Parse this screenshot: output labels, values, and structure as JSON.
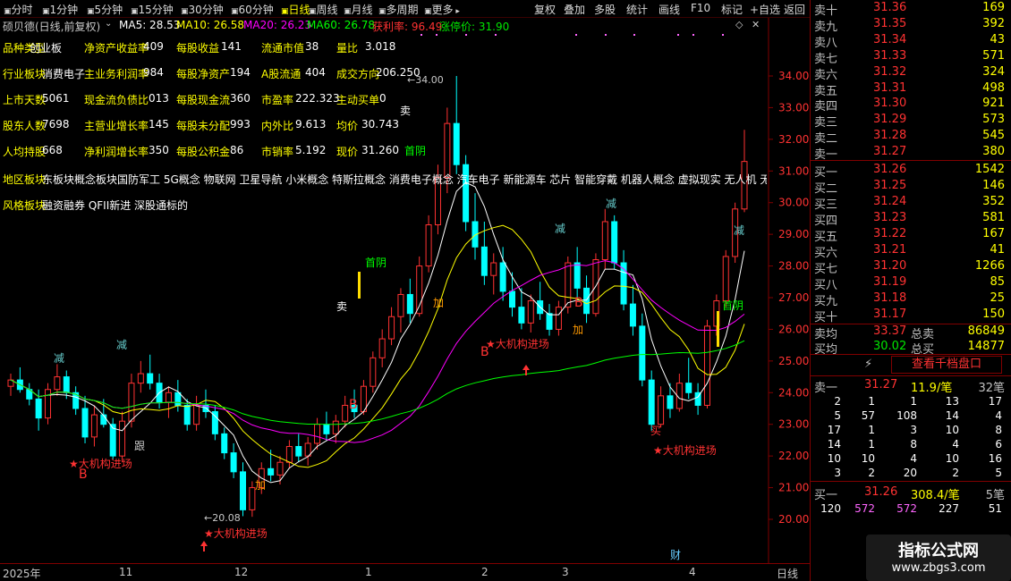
{
  "toolbar": {
    "left_items": [
      "分时",
      "1分钟",
      "5分钟",
      "15分钟",
      "30分钟",
      "60分钟",
      "日线",
      "周线",
      "月线",
      "多周期",
      "更多"
    ],
    "active": "日线",
    "right_items": [
      "复权",
      "叠加",
      "多股",
      "统计",
      "画线",
      "F10",
      "标记",
      "+自选",
      "返回"
    ]
  },
  "title": {
    "stock": "硕贝德(日线,前复权)",
    "ma5": "MA5: 28.53",
    "ma10": "MA10: 26.58",
    "ma20": "MA20: 26.23",
    "ma60": "MA60: 26.78",
    "profit": "获利率: 96.49",
    "limitup": "涨停价: 31.90"
  },
  "info": {
    "row1": [
      [
        "品种类型",
        "创业板"
      ],
      [
        "净资产收益率",
        "409"
      ],
      [
        "每股收益",
        "141"
      ],
      [
        "流通市值",
        "38"
      ],
      [
        "量比",
        "3.018"
      ]
    ],
    "row2": [
      [
        "行业板块",
        "消费电子"
      ],
      [
        "主业务利润率",
        "984"
      ],
      [
        "每股净资产",
        "194"
      ],
      [
        "A股流通",
        "404"
      ],
      [
        "成交方向",
        "206.250"
      ]
    ],
    "row3": [
      [
        "上市天数",
        "5061"
      ],
      [
        "现金流负债比",
        "013"
      ],
      [
        "每股现金流",
        "360"
      ],
      [
        "市盈率",
        "222.323"
      ],
      [
        "主动买单",
        "0"
      ]
    ],
    "row4": [
      [
        "股东人数",
        "7698"
      ],
      [
        "主营业增长率",
        "145"
      ],
      [
        "每股未分配",
        "993"
      ],
      [
        "内外比",
        "9.613"
      ],
      [
        "均价",
        "30.743"
      ]
    ],
    "row5": [
      [
        "人均持股",
        "668"
      ],
      [
        "净利润增长率",
        "350"
      ],
      [
        "每股公积金",
        "86"
      ],
      [
        "市销率",
        "5.192"
      ],
      [
        "现价",
        "31.260"
      ]
    ],
    "region_label": "地区板块",
    "region_value": "东板块概念板块国防军工 5G概念 物联网 卫星导航 小米概念 特斯拉概念 消费电子概念 汽车电子 新能源车 芯片 智能穿戴 机器人概念 虚拟现实 无人机 无",
    "style_label": "风格板块",
    "style_value": "融资融券 QFII新进 深股通标的"
  },
  "chart_data": {
    "type": "candlestick",
    "y_ticks": [
      "34.00",
      "33.00",
      "32.00",
      "31.00",
      "30.00",
      "29.00",
      "28.00",
      "27.00",
      "26.00",
      "25.00",
      "24.00",
      "23.00",
      "22.00",
      "21.00",
      "20.00"
    ],
    "ylim": [
      19.5,
      34.5
    ],
    "x_labels": [
      "2025年",
      "11",
      "12",
      "1",
      "2",
      "3",
      "4"
    ],
    "period_label": "日线",
    "high_mark": "34.00",
    "low_mark": "20.08",
    "candles": [
      [
        24.2,
        24.6,
        23.9,
        24.4
      ],
      [
        24.4,
        24.8,
        24.0,
        24.1
      ],
      [
        24.1,
        24.3,
        23.6,
        23.8
      ],
      [
        23.8,
        24.1,
        22.8,
        23.2
      ],
      [
        23.2,
        24.3,
        23.0,
        24.1
      ],
      [
        24.1,
        24.9,
        23.9,
        24.5
      ],
      [
        24.5,
        24.7,
        23.8,
        24.0
      ],
      [
        24.0,
        24.2,
        23.3,
        23.5
      ],
      [
        23.5,
        23.9,
        22.4,
        22.6
      ],
      [
        22.6,
        23.6,
        22.3,
        23.3
      ],
      [
        23.3,
        23.8,
        22.9,
        23.0
      ],
      [
        23.0,
        23.2,
        21.9,
        22.0
      ],
      [
        22.0,
        23.4,
        21.8,
        23.1
      ],
      [
        23.1,
        24.6,
        22.9,
        24.3
      ],
      [
        24.3,
        25.0,
        24.0,
        24.6
      ],
      [
        24.6,
        25.2,
        24.1,
        24.3
      ],
      [
        24.3,
        24.6,
        23.5,
        23.7
      ],
      [
        23.7,
        24.2,
        23.2,
        24.0
      ],
      [
        24.0,
        24.4,
        23.4,
        23.6
      ],
      [
        23.6,
        23.8,
        22.8,
        23.0
      ],
      [
        23.0,
        23.9,
        22.8,
        23.6
      ],
      [
        23.6,
        24.1,
        23.2,
        23.4
      ],
      [
        23.4,
        23.6,
        22.5,
        22.7
      ],
      [
        22.7,
        22.9,
        21.9,
        22.1
      ],
      [
        22.1,
        22.4,
        21.3,
        21.5
      ],
      [
        21.5,
        21.8,
        20.1,
        20.3
      ],
      [
        20.3,
        21.2,
        20.08,
        21.0
      ],
      [
        21.0,
        21.8,
        20.8,
        21.6
      ],
      [
        21.6,
        22.2,
        21.2,
        21.4
      ],
      [
        21.4,
        22.0,
        21.1,
        21.8
      ],
      [
        21.8,
        22.5,
        21.6,
        22.3
      ],
      [
        22.3,
        22.7,
        21.8,
        22.0
      ],
      [
        22.0,
        22.6,
        21.7,
        22.4
      ],
      [
        22.4,
        23.2,
        22.2,
        23.0
      ],
      [
        23.0,
        23.4,
        22.5,
        22.7
      ],
      [
        22.7,
        23.3,
        22.4,
        23.1
      ],
      [
        23.1,
        23.9,
        22.9,
        23.6
      ],
      [
        23.6,
        24.1,
        23.2,
        23.4
      ],
      [
        23.4,
        24.4,
        23.3,
        24.2
      ],
      [
        24.2,
        25.3,
        24.0,
        25.1
      ],
      [
        25.1,
        26.0,
        24.8,
        25.7
      ],
      [
        25.7,
        26.7,
        25.5,
        26.4
      ],
      [
        26.4,
        27.3,
        25.9,
        27.1
      ],
      [
        27.1,
        27.6,
        26.2,
        26.5
      ],
      [
        26.5,
        28.3,
        26.4,
        28.0
      ],
      [
        28.0,
        29.6,
        27.8,
        29.3
      ],
      [
        29.3,
        31.2,
        29.0,
        30.8
      ],
      [
        30.8,
        33.0,
        30.3,
        32.5
      ],
      [
        32.5,
        34.0,
        30.9,
        31.2
      ],
      [
        31.2,
        31.5,
        29.1,
        29.4
      ],
      [
        29.4,
        30.3,
        28.2,
        28.6
      ],
      [
        28.6,
        29.4,
        27.4,
        27.7
      ],
      [
        27.7,
        28.4,
        27.1,
        28.1
      ],
      [
        28.1,
        28.6,
        26.9,
        27.2
      ],
      [
        27.2,
        27.8,
        26.4,
        26.7
      ],
      [
        26.7,
        27.3,
        26.0,
        26.2
      ],
      [
        26.2,
        27.1,
        25.9,
        26.9
      ],
      [
        26.9,
        27.5,
        26.3,
        26.5
      ],
      [
        26.5,
        26.8,
        25.8,
        26.0
      ],
      [
        26.0,
        26.9,
        25.8,
        26.7
      ],
      [
        26.7,
        28.3,
        26.5,
        28.1
      ],
      [
        28.1,
        28.6,
        27.0,
        27.3
      ],
      [
        27.3,
        27.7,
        26.2,
        26.5
      ],
      [
        26.5,
        28.4,
        26.4,
        28.2
      ],
      [
        28.2,
        29.8,
        27.9,
        29.4
      ],
      [
        29.4,
        29.6,
        27.9,
        28.1
      ],
      [
        28.1,
        28.5,
        26.6,
        26.8
      ],
      [
        26.8,
        27.4,
        25.8,
        26.1
      ],
      [
        26.1,
        26.5,
        24.2,
        24.4
      ],
      [
        24.4,
        24.7,
        22.8,
        23.0
      ],
      [
        23.0,
        24.2,
        22.9,
        23.9
      ],
      [
        23.9,
        24.3,
        23.2,
        23.5
      ],
      [
        23.5,
        24.6,
        23.4,
        24.3
      ],
      [
        24.3,
        25.1,
        23.8,
        24.0
      ],
      [
        24.0,
        24.3,
        23.3,
        23.6
      ],
      [
        23.6,
        26.3,
        23.5,
        26.1
      ],
      [
        26.1,
        27.1,
        25.8,
        26.9
      ],
      [
        26.9,
        28.5,
        26.7,
        28.3
      ],
      [
        28.3,
        30.0,
        28.1,
        29.8
      ],
      [
        29.8,
        32.3,
        29.7,
        31.3
      ]
    ],
    "series": [
      {
        "name": "MA5",
        "color": "#ffffff"
      },
      {
        "name": "MA10",
        "color": "#ffff00"
      },
      {
        "name": "MA20",
        "color": "#ff00ff"
      },
      {
        "name": "MA60",
        "color": "#00ff00"
      }
    ],
    "annotations": [
      "减",
      "卖",
      "B",
      "跟",
      "加",
      "首阴",
      "★大机构进场",
      "买",
      "财",
      "减"
    ]
  },
  "orderbook": {
    "asks": [
      {
        "label": "卖十",
        "price": "31.36",
        "vol": "169"
      },
      {
        "label": "卖九",
        "price": "31.35",
        "vol": "392"
      },
      {
        "label": "卖八",
        "price": "31.34",
        "vol": "43"
      },
      {
        "label": "卖七",
        "price": "31.33",
        "vol": "571"
      },
      {
        "label": "卖六",
        "price": "31.32",
        "vol": "324"
      },
      {
        "label": "卖五",
        "price": "31.31",
        "vol": "498"
      },
      {
        "label": "卖四",
        "price": "31.30",
        "vol": "921"
      },
      {
        "label": "卖三",
        "price": "31.29",
        "vol": "573"
      },
      {
        "label": "卖二",
        "price": "31.28",
        "vol": "545"
      },
      {
        "label": "卖一",
        "price": "31.27",
        "vol": "380"
      }
    ],
    "bids": [
      {
        "label": "买一",
        "price": "31.26",
        "vol": "1542"
      },
      {
        "label": "买二",
        "price": "31.25",
        "vol": "146"
      },
      {
        "label": "买三",
        "price": "31.24",
        "vol": "352"
      },
      {
        "label": "买四",
        "price": "31.23",
        "vol": "581"
      },
      {
        "label": "买五",
        "price": "31.22",
        "vol": "167"
      },
      {
        "label": "买六",
        "price": "31.21",
        "vol": "41"
      },
      {
        "label": "买七",
        "price": "31.20",
        "vol": "1266"
      },
      {
        "label": "买八",
        "price": "31.19",
        "vol": "85"
      },
      {
        "label": "买九",
        "price": "31.18",
        "vol": "25"
      },
      {
        "label": "买十",
        "price": "31.17",
        "vol": "150"
      }
    ],
    "avg_ask_label": "卖均",
    "avg_ask": "33.37",
    "total_ask_label": "总卖",
    "total_ask": "86849",
    "avg_bid_label": "买均",
    "avg_bid": "30.02",
    "total_bid_label": "总买",
    "total_bid": "14877",
    "view_button": "查看千档盘口",
    "sell1_label": "卖一",
    "sell1_price": "31.27",
    "sell1_per": "11.9/笔",
    "sell1_count": "32笔",
    "sell_grid": [
      [
        "2",
        "1",
        "1",
        "13",
        "17"
      ],
      [
        "5",
        "57",
        "108",
        "14",
        "4"
      ],
      [
        "17",
        "1",
        "3",
        "10",
        "8"
      ],
      [
        "14",
        "1",
        "8",
        "4",
        "6"
      ],
      [
        "10",
        "10",
        "4",
        "10",
        "16"
      ],
      [
        "3",
        "2",
        "20",
        "2",
        "5"
      ]
    ],
    "buy1_label": "买一",
    "buy1_price": "31.26",
    "buy1_per": "308.4/笔",
    "buy1_count": "5笔",
    "buy_grid": [
      "120",
      "572",
      "572",
      "227",
      "51"
    ]
  },
  "watermark": {
    "title": "指标公式网",
    "url": "www.zbgs3.com"
  }
}
